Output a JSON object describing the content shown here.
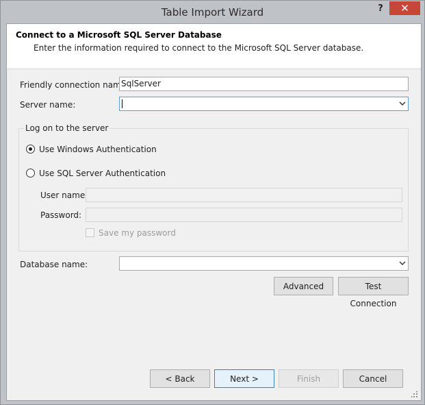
{
  "window": {
    "title": "Table Import Wizard",
    "help_glyph": "?",
    "close_glyph": "✕"
  },
  "header": {
    "title": "Connect to a Microsoft SQL Server Database",
    "subtitle": "Enter the information required to connect to the Microsoft SQL Server database."
  },
  "form": {
    "friendly_name_label": "Friendly connection name:",
    "friendly_name_value": "SqlServer",
    "server_name_label": "Server name:",
    "server_name_value": "",
    "logon_group_label": "Log on to the server",
    "windows_auth_label": "Use Windows Authentication",
    "windows_auth_selected": true,
    "sql_auth_label": "Use SQL Server Authentication",
    "sql_auth_selected": false,
    "username_label": "User name:",
    "username_value": "",
    "password_label": "Password:",
    "password_value": "",
    "save_password_label": "Save my password",
    "save_password_checked": false,
    "database_name_label": "Database name:",
    "database_name_value": ""
  },
  "buttons": {
    "advanced": "Advanced",
    "test_connection": "Test Connection",
    "back": "< Back",
    "next": "Next >",
    "finish": "Finish",
    "cancel": "Cancel"
  },
  "colors": {
    "close_button": "#c7463a",
    "focus_border": "#5c9bd5",
    "default_button_border": "#3c7fb1"
  }
}
